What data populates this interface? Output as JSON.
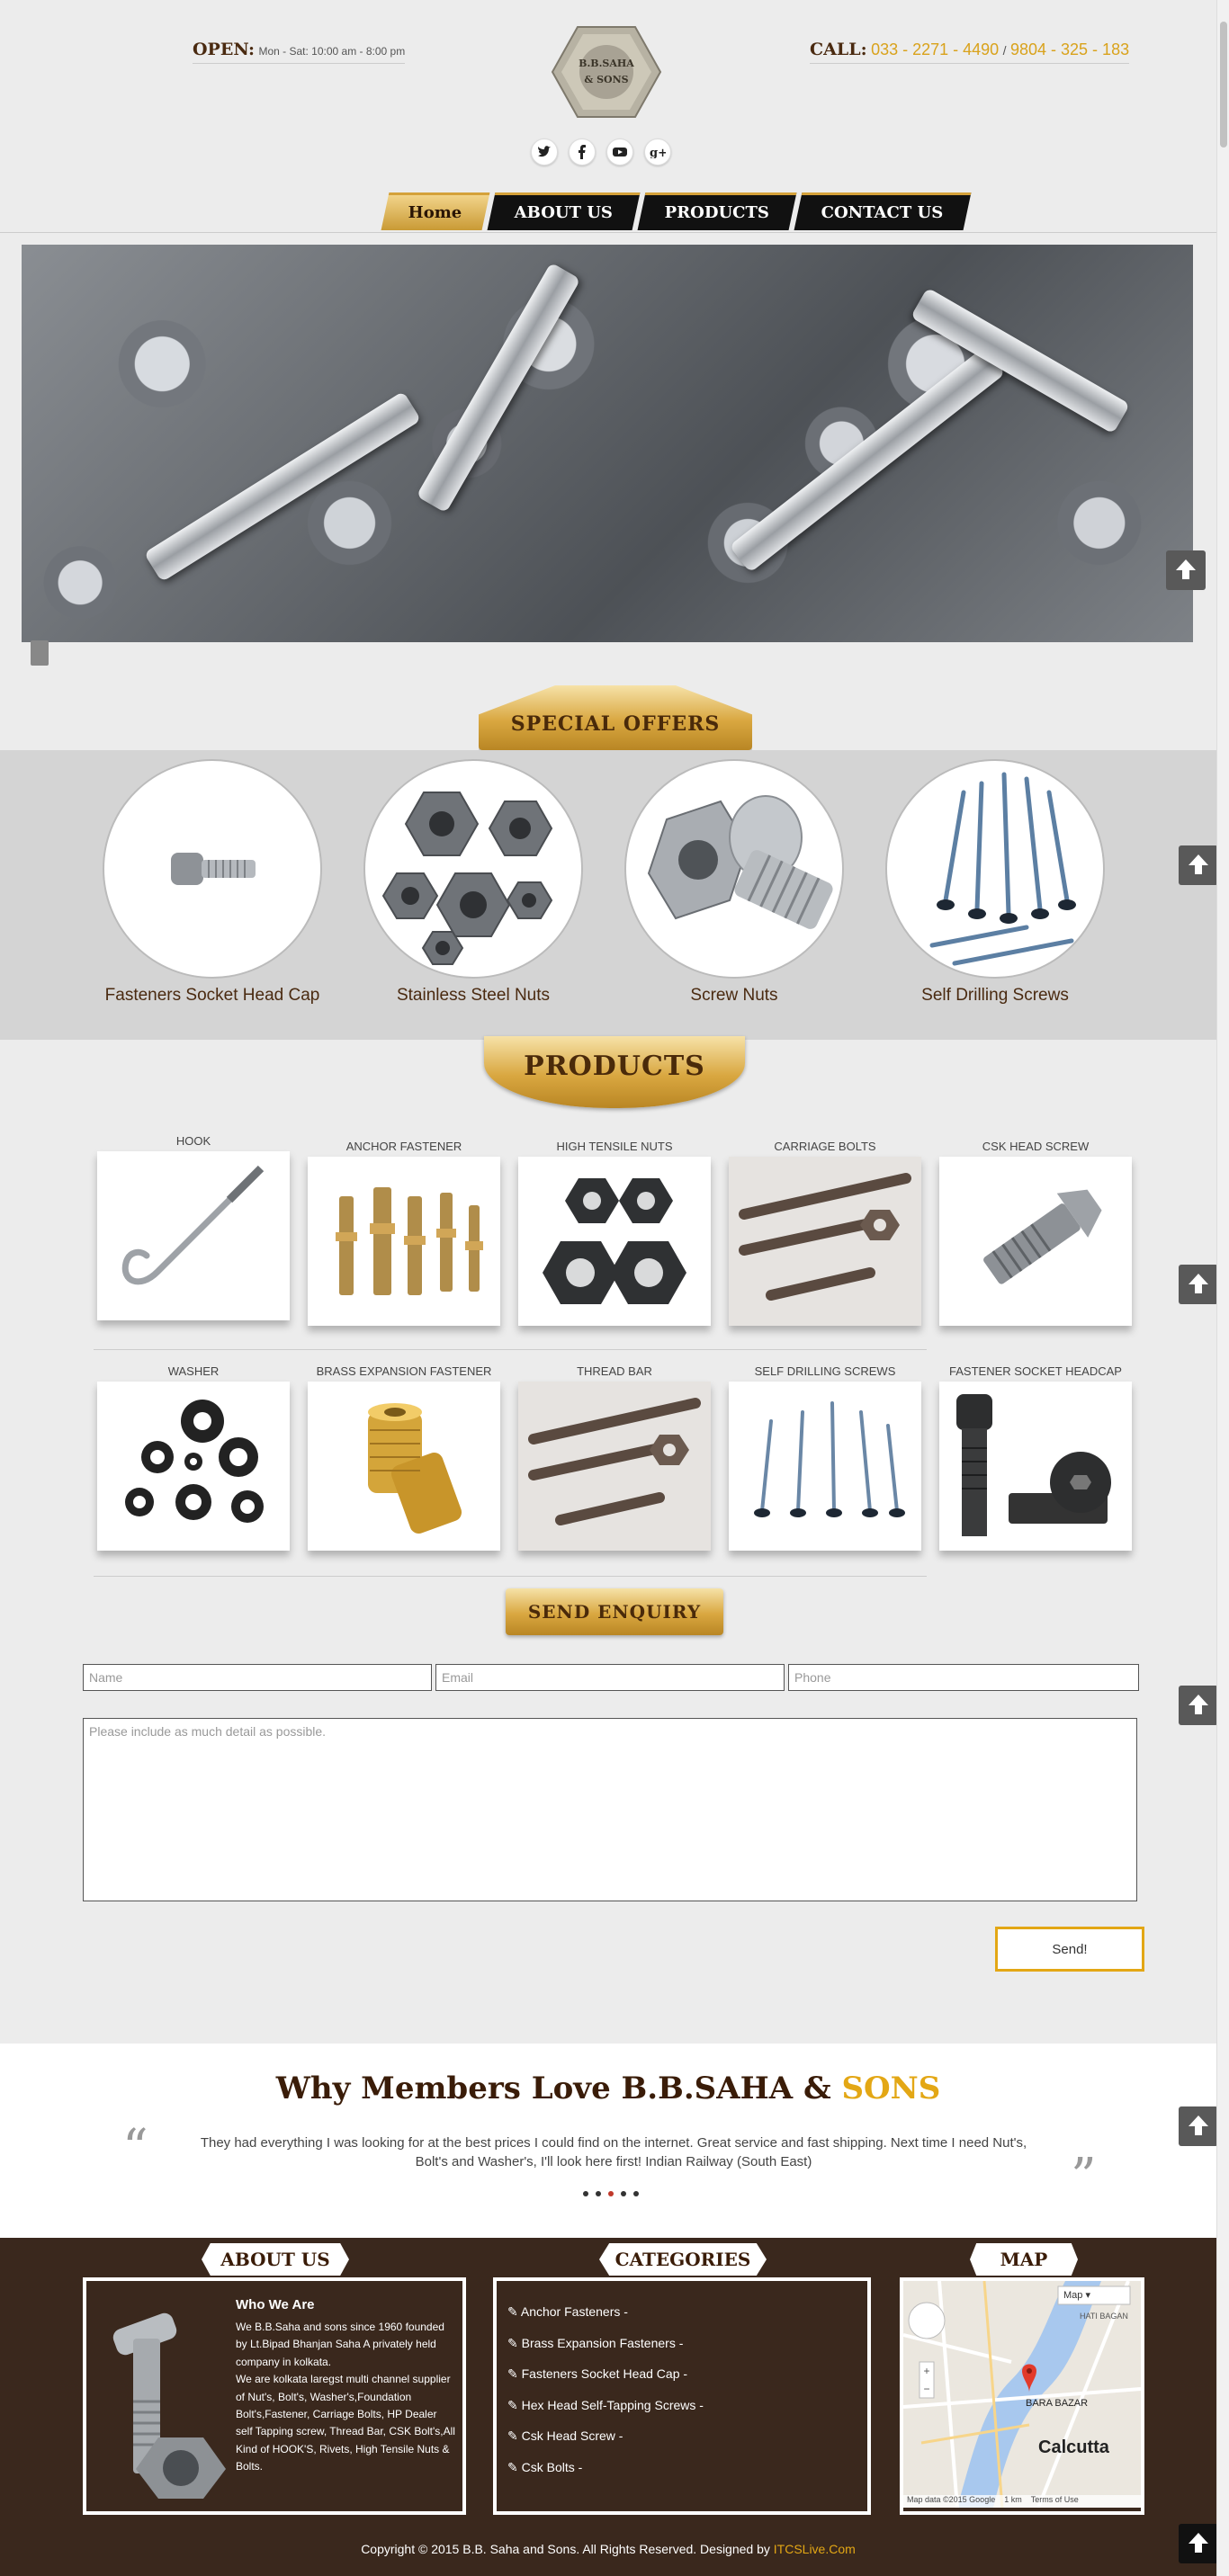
{
  "header": {
    "open_label": "OPEN:",
    "open_hours": "Mon - Sat: 10:00 am - 8:00 pm",
    "call_label": "CALL:",
    "phone_1": "033 - 2271 - 4490",
    "phone_sep": "/",
    "phone_2": "9804 - 325 - 183",
    "logo_text": "B.B.SAHA & SONS",
    "social": [
      "twitter-icon",
      "facebook-icon",
      "youtube-icon",
      "google-plus-icon"
    ]
  },
  "nav": [
    "Home",
    "ABOUT US",
    "PRODUCTS",
    "CONTACT US"
  ],
  "banners": {
    "offers": "SPECIAL OFFERS",
    "products": "PRODUCTS",
    "enquiry": "SEND ENQUIRY"
  },
  "offers": [
    "Fasteners Socket Head Cap",
    "Stainless Steel Nuts",
    "Screw Nuts",
    "Self Drilling Screws"
  ],
  "products_row1": [
    "HOOK",
    "ANCHOR FASTENER",
    "HIGH TENSILE NUTS",
    "CARRIAGE BOLTS",
    "CSK HEAD SCREW"
  ],
  "products_row2": [
    "WASHER",
    "BRASS EXPANSION FASTENER",
    "THREAD BAR",
    "SELF DRILLING SCREWS",
    "FASTENER SOCKET HEADCAP"
  ],
  "form": {
    "name_placeholder": "Name",
    "email_placeholder": "Email",
    "phone_placeholder": "Phone",
    "message_placeholder": "Please include as much detail as possible.",
    "send_label": "Send!"
  },
  "testimonials": {
    "title_main": "Why Members Love B.B.SAHA &",
    "title_highlight": "SONS",
    "quote": "They had everything I was looking for at the best prices I could find on the internet. Great service and fast shipping. Next time I need Nut's, Bolt's and Washer's, I'll look here first! Indian Railway (South East)"
  },
  "footer": {
    "about_tab": "ABOUT US",
    "categories_tab": "CATEGORIES",
    "map_tab": "MAP",
    "about_title": "Who We Are",
    "about_text_1": "We B.B.Saha and sons since 1960 founded by Lt.Bipad Bhanjan Saha A privately held company in kolkata.",
    "about_text_2": "We are kolkata laregst multi channel supplier of Nut's, Bolt's, Washer's,Foundation Bolt's,Fastener, Carriage Bolts, HP Dealer self Tapping screw, Thread Bar, CSK Bolt's,All Kind of HOOK'S, Rivets, High Tensile Nuts & Bolts.",
    "categories": [
      "Anchor Fasteners -",
      "Brass Expansion Fasteners -",
      "Fasteners Socket Head Cap -",
      "Hex Head Self-Tapping Screws -",
      "Csk Head Screw -",
      "Csk Bolts -"
    ],
    "map_type": "Map",
    "map_labels": [
      "Calcutta",
      "BARA BAZAR",
      "HATI BAGAN"
    ],
    "map_attrib": "Map data ©2015 Google",
    "map_scale": "1 km",
    "map_terms": "Terms of Use",
    "copyright": "Copyright © 2015 B.B. Saha and Sons. All Rights Reserved. Designed by",
    "designer": "ITCSLive.Com"
  }
}
